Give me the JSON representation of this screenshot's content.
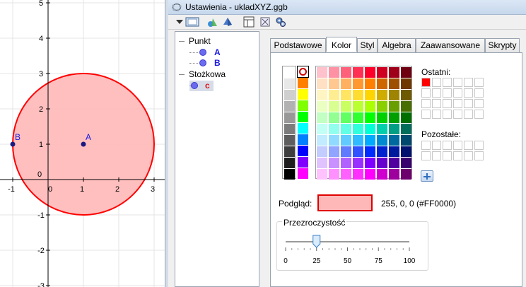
{
  "window": {
    "title": "Ustawienia - ukladXYZ.ggb"
  },
  "graphics": {
    "x_ticks": [
      "-1",
      "0",
      "1",
      "2",
      "3"
    ],
    "y_ticks": [
      "5",
      "4",
      "3",
      "2",
      "1",
      "0",
      "-1",
      "-2",
      "-3"
    ],
    "point_a_label": "A",
    "point_b_label": "B",
    "circle_color": "#ff0000",
    "circle_fill": "#ffb8b8"
  },
  "toolbar": {
    "icons": [
      "dropdown-arrow-icon",
      "graphics-view-icon",
      "objects-icon",
      "3d-view-icon",
      "layout-icon",
      "defaults-icon",
      "settings-gear-icon"
    ]
  },
  "tree": {
    "categories": [
      {
        "label": "Punkt",
        "items": [
          "A",
          "B"
        ]
      },
      {
        "label": "Stożkowa",
        "items": [
          "c"
        ]
      }
    ]
  },
  "tabs": [
    "Podstawowe",
    "Kolor",
    "Styl",
    "Algebra",
    "Zaawansowane",
    "Skrypty"
  ],
  "active_tab": "Kolor",
  "color_panel": {
    "recent_label": "Ostatni:",
    "other_label": "Pozostałe:",
    "preview_label": "Podgląd:",
    "preview_value": "255, 0, 0 (#FF0000)",
    "preview_color": "#ff0000",
    "transparency_label": "Przezroczystość",
    "slider_ticks": [
      "0",
      "25",
      "50",
      "75",
      "100"
    ],
    "slider_value": 25,
    "recent_color": "#ff0000"
  }
}
